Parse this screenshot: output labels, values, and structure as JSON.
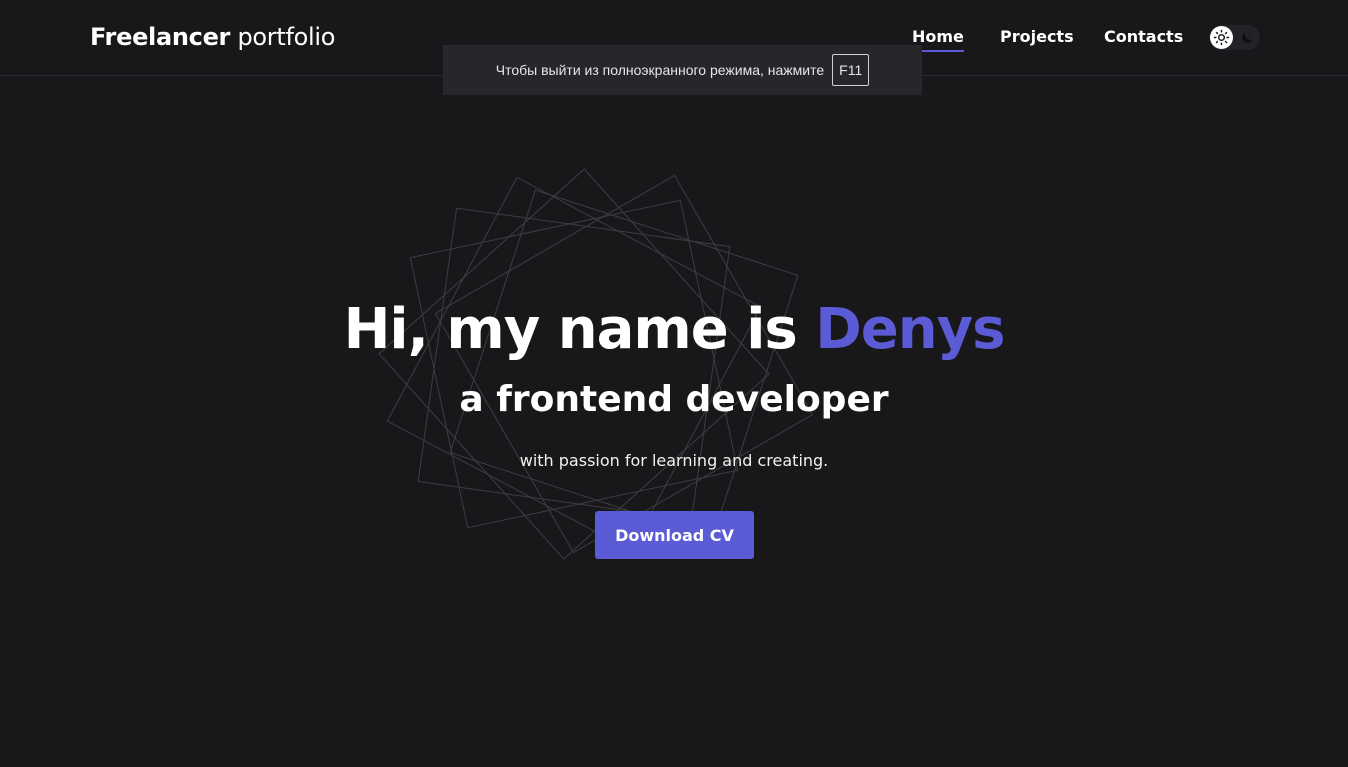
{
  "header": {
    "logo_bold": "Freelancer",
    "logo_light": "portfolio",
    "nav": {
      "home": "Home",
      "projects": "Projects",
      "contacts": "Contacts"
    },
    "active_nav": "home",
    "theme": "dark"
  },
  "fullscreen_notice": {
    "text": "Чтобы выйти из полноэкранного режима, нажмите",
    "key": "F11"
  },
  "hero": {
    "greeting": "Hi, my name is ",
    "name": "Denys",
    "subtitle": "a frontend developer",
    "tagline": "with passion for learning and creating.",
    "cta_label": "Download CV"
  },
  "colors": {
    "background": "#18181b",
    "accent": "#5b5bd6",
    "text": "#ffffff"
  },
  "icons": [
    "sun-icon",
    "moon-icon"
  ]
}
